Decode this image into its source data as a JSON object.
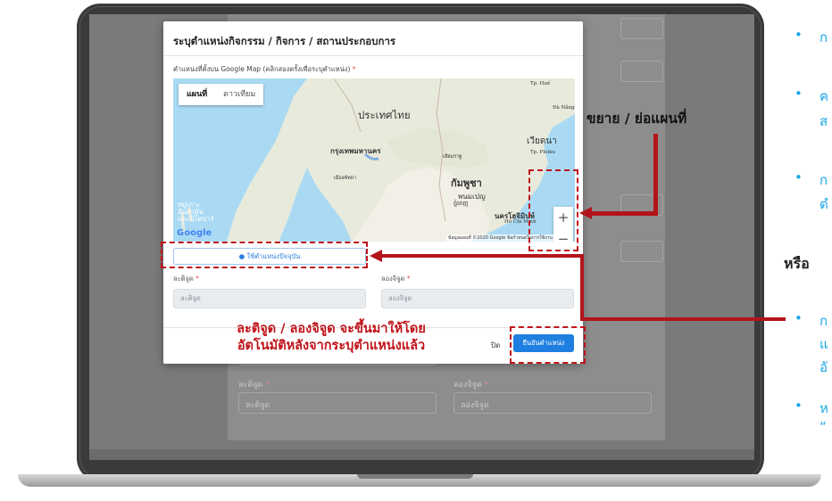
{
  "modal": {
    "title": "ระบุตำแหน่งกิจกรรม / กิจการ / สถานประกอบการ",
    "map_label": "ตำแหน่งที่ตั้งบน Google Map (คลิกสองครั้งเพื่อระบุตำแหน่ง)",
    "map_label_required": "*",
    "map_type_tabs": [
      {
        "label": "แผนที่",
        "active": true
      },
      {
        "label": "ดาวเทียม",
        "active": false
      }
    ],
    "map_places": {
      "thailand": "ประเทศไทย",
      "bangkok": "กรุงเทพมหานคร",
      "cambodia": "กัมพูชา",
      "phnom_penh": "พนมเปญ",
      "phnom_penh_sub": "ភ្នំពេញ",
      "vietnam": "เวียดนา",
      "hcm": "นครโฮจิมินห์",
      "hcm_sub": "Hồ Chí Minh",
      "islands": "หมู่เกาะ อันดามัน และนิโคบาร์",
      "tp_hue": "Tp. Huế",
      "da_nang": "Đà Nẵng",
      "pleiku": "Tp. Pleiku",
      "pattaya": "เมืองพัทยา",
      "siem_reap": "เสียมราฐ"
    },
    "google_logo": "Google",
    "map_credit": "ข้อมูลแผนที่ ©2020 Google   ข้อกำหนดในการใช้งาน",
    "zoom_in": "+",
    "zoom_out": "−",
    "use_location_label": "ใช้ตำแหน่งปัจจุบัน",
    "latitude_label": "ละติจูด",
    "latitude_placeholder": "ละติจูด",
    "longitude_label": "ลองจิจูด",
    "longitude_placeholder": "ลองจิจูด",
    "required_mark": "*",
    "close_label": "ปิด",
    "confirm_label": "ยืนยันตำแหน่ง"
  },
  "background_form": {
    "latitude_label": "ละติจูด",
    "latitude_placeholder": "ละติจูด",
    "longitude_label": "ลองจิจูด",
    "longitude_placeholder": "ลองจิจูด"
  },
  "annotations": {
    "zoom_label": "ขยาย / ย่อแผนที่",
    "auto_fill_line1": "ละติจูด / ลองจิจูด จะขึ้นมาให้โดย",
    "auto_fill_line2": "อัตโนมัติหลังจากระบุตำแหน่งแล้ว"
  },
  "right_panel": {
    "bullet_1": "ก",
    "bullet_2_l1": "ค",
    "bullet_2_l2": "ส",
    "bullet_3_l1": "ก",
    "bullet_3_l2": "ตํ",
    "or_heading": "หรือ",
    "bullet_4_l1": "ก",
    "bullet_4_l2": "แ",
    "bullet_4_l3": "อั",
    "bullet_5_l1": "ห",
    "bullet_5_l2": "“"
  },
  "colors": {
    "accent_red": "#c0141b",
    "primary_blue": "#1f7fe0",
    "bullet_blue": "#1aa7e6"
  }
}
